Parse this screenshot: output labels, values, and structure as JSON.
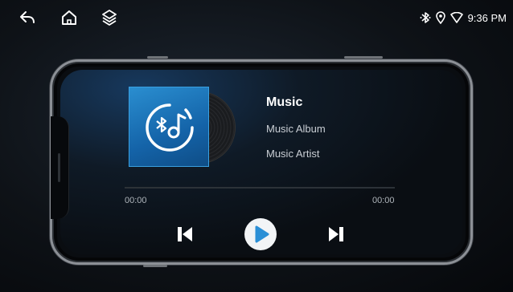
{
  "status_bar": {
    "icons": [
      "back-icon",
      "home-icon",
      "layers-icon"
    ],
    "right_icons": [
      "bluetooth-icon",
      "location-icon",
      "wifi-icon"
    ],
    "time": "9:36 PM"
  },
  "player": {
    "title": "Music",
    "album": "Music Album",
    "artist": "Music Artist",
    "elapsed": "00:00",
    "duration": "00:00",
    "progress": 0,
    "controls": [
      "previous-icon",
      "play-icon",
      "next-icon"
    ]
  },
  "colors": {
    "cover_blue": "#1a72b8",
    "accent": "#2b8fd6",
    "text_primary": "#ffffff",
    "text_secondary": "#c9ced4"
  }
}
